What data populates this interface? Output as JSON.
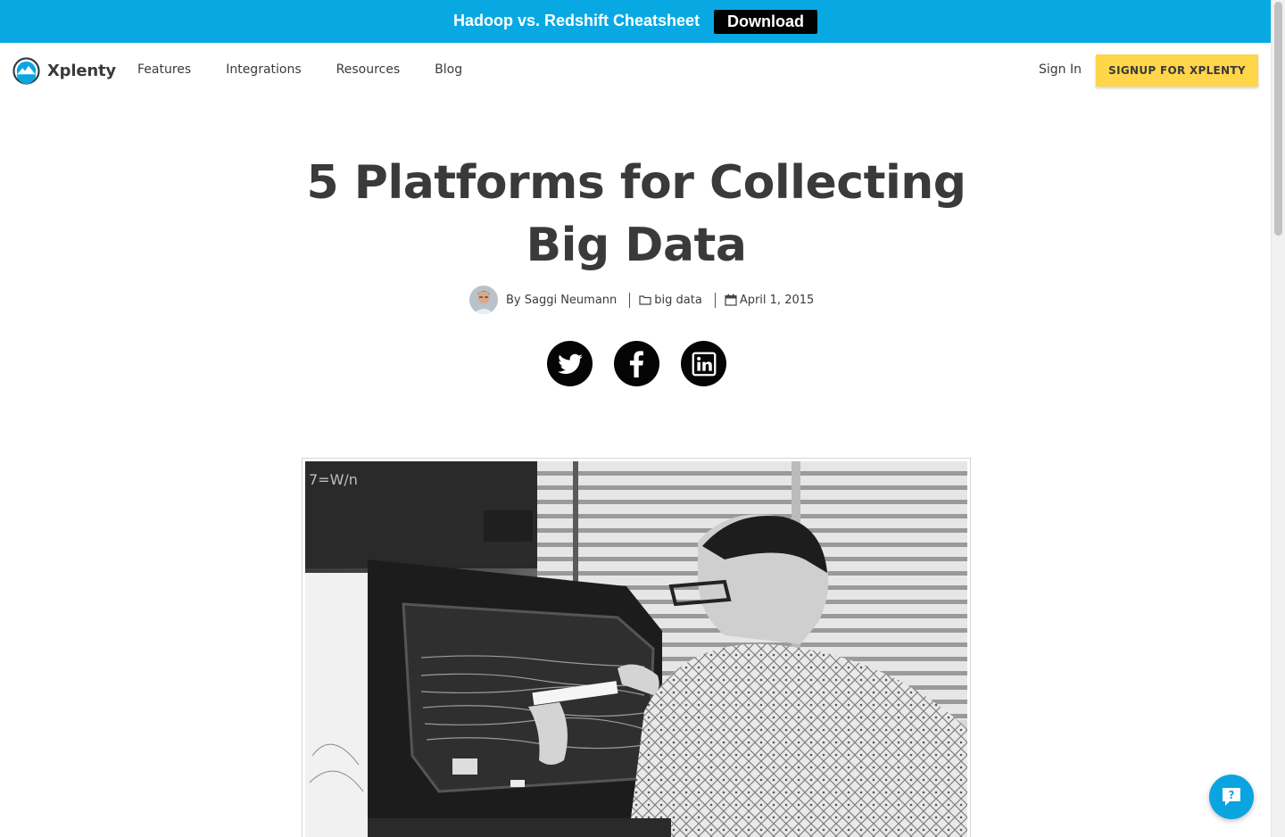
{
  "promo": {
    "text": "Hadoop vs. Redshift Cheatsheet",
    "button": "Download"
  },
  "nav": {
    "brand": "Xplenty",
    "links": [
      "Features",
      "Integrations",
      "Resources",
      "Blog"
    ],
    "signin": "Sign In",
    "signup": "SIGNUP FOR XPLENTY"
  },
  "article": {
    "title": "5 Platforms for Collecting Big Data",
    "author": "By Saggi Neumann",
    "category": "big data",
    "date": "April 1, 2015"
  },
  "social": [
    "twitter-icon",
    "facebook-icon",
    "linkedin-icon"
  ],
  "hero_image": {
    "blackboard_text": "7=W/n",
    "description_icon": "photo-vintage-engineer-with-oscilloscope"
  },
  "colors": {
    "promo_bg": "#08a9e3",
    "signup_bg": "#ffd54a",
    "help_bg": "#0aa4e0"
  },
  "help_icon": "chat-question-icon"
}
